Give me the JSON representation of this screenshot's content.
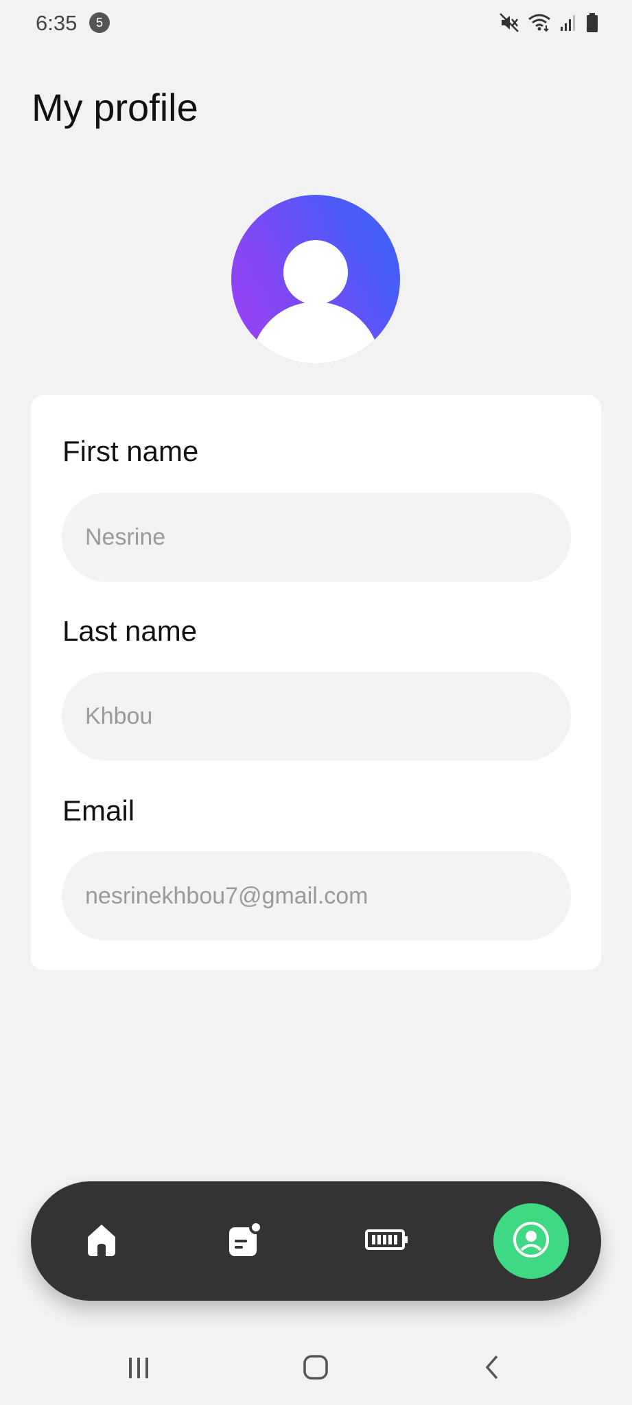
{
  "status_bar": {
    "time": "6:35",
    "notification_count": "5",
    "icons": [
      "mute-icon",
      "wifi-icon",
      "signal-icon",
      "battery-icon"
    ]
  },
  "page": {
    "title": "My profile"
  },
  "avatar": {
    "icon": "user-avatar-icon",
    "gradient": [
      "#a23ff4",
      "#3b63f8"
    ]
  },
  "form": {
    "first_name": {
      "label": "First name",
      "value": "Nesrine"
    },
    "last_name": {
      "label": "Last name",
      "value": "Khbou"
    },
    "email": {
      "label": "Email",
      "value": "nesrinekhbou7@gmail.com"
    }
  },
  "bottom_nav": {
    "items": [
      {
        "icon": "home-icon",
        "active": false
      },
      {
        "icon": "notes-icon",
        "active": false
      },
      {
        "icon": "battery-icon",
        "active": false
      },
      {
        "icon": "profile-icon",
        "active": true
      }
    ],
    "active_color": "#3fd984",
    "background": "#333333"
  },
  "system_nav": {
    "icons": [
      "recents-icon",
      "home-button-icon",
      "back-icon"
    ]
  }
}
